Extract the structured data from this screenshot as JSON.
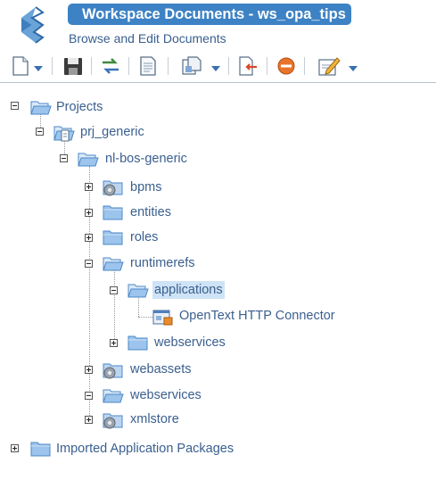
{
  "header": {
    "title": "Workspace Documents - ws_opa_tips",
    "subtitle": "Browse and Edit Documents"
  },
  "toolbar": {
    "buttons": [
      {
        "name": "new-document-icon"
      },
      {
        "name": "save-icon"
      },
      {
        "name": "synchronize-icon"
      },
      {
        "name": "properties-icon"
      },
      {
        "name": "copy-icon"
      },
      {
        "name": "export-icon"
      },
      {
        "name": "delete-icon"
      },
      {
        "name": "edit-icon"
      }
    ]
  },
  "tree": {
    "projects": "Projects",
    "prj_generic": "prj_generic",
    "nl_bos_generic": "nl-bos-generic",
    "bpms": "bpms",
    "entities": "entities",
    "roles": "roles",
    "runtimerefs": "runtimerefs",
    "applications": "applications",
    "http_connector": "OpenText HTTP Connector",
    "webservices_inner": "webservices",
    "webassets": "webassets",
    "webservices": "webservices",
    "xmlstore": "xmlstore",
    "imported": "Imported Application Packages"
  },
  "colors": {
    "title_bg": "#3d82c4",
    "link_text": "#3a5f8e",
    "selection": "#cfe3f6"
  }
}
